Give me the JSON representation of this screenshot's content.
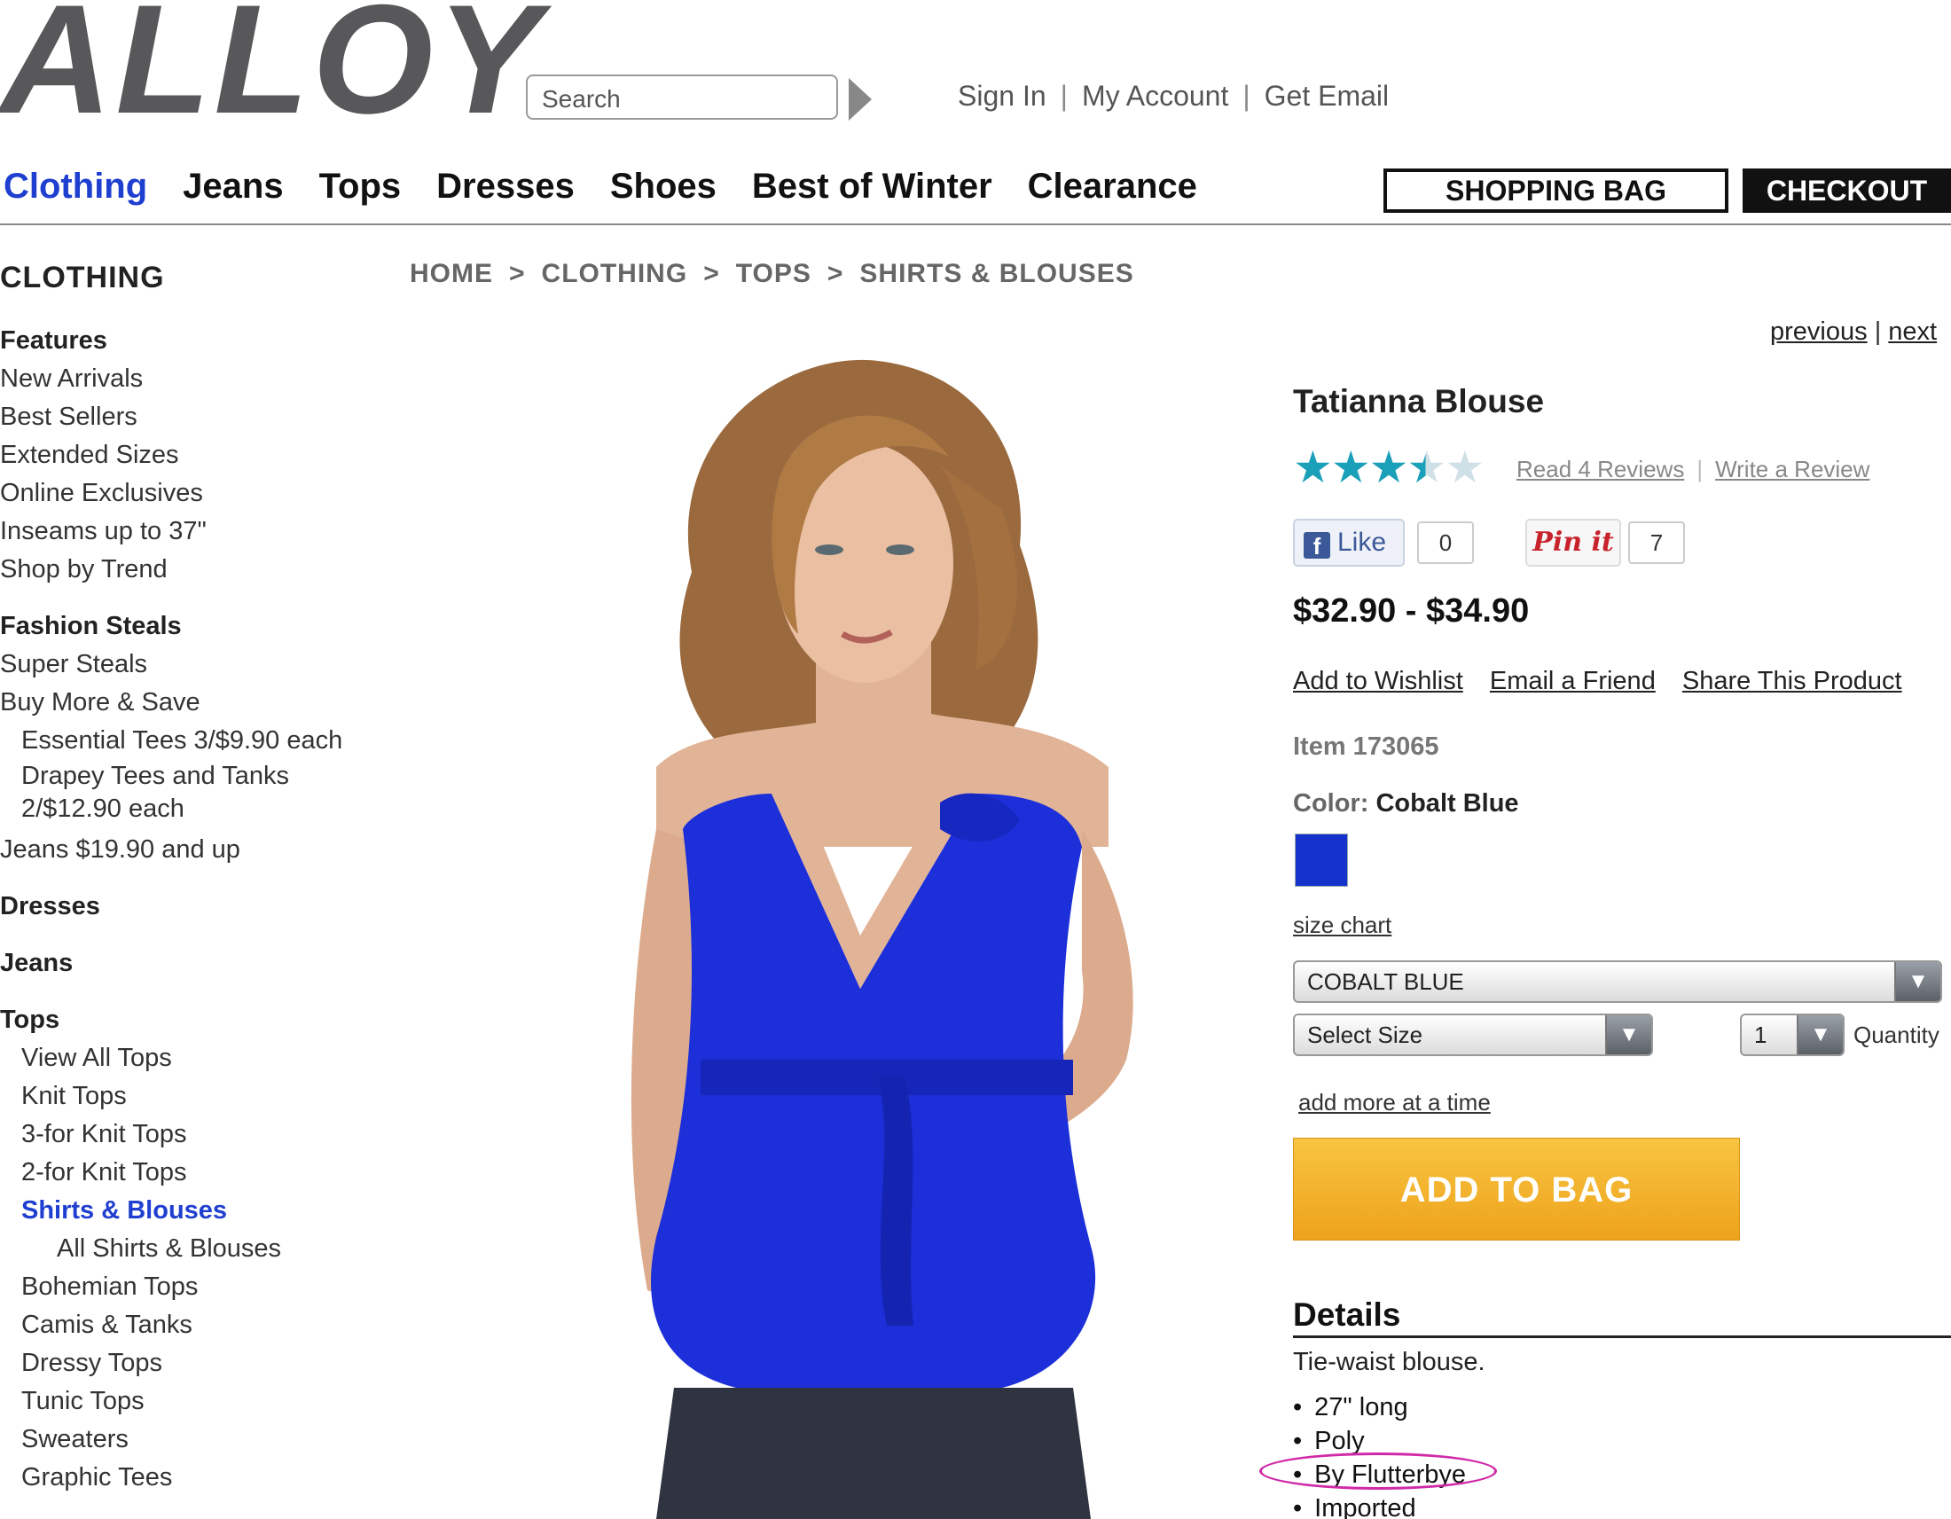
{
  "header": {
    "logo": "ALLOY",
    "search_placeholder": "Search",
    "sign_in": "Sign In",
    "my_account": "My Account",
    "get_email": "Get Email",
    "separator": "|"
  },
  "nav": {
    "items": [
      "Clothing",
      "Jeans",
      "Tops",
      "Dresses",
      "Shoes",
      "Best of Winter",
      "Clearance"
    ],
    "shopping_bag": "SHOPPING BAG",
    "checkout": "CHECKOUT"
  },
  "sidebar": {
    "title": "CLOTHING",
    "features": "Features",
    "new_arrivals": "New Arrivals",
    "best_sellers": "Best Sellers",
    "extended_sizes": "Extended Sizes",
    "online_exclusives": "Online Exclusives",
    "inseams": "Inseams up to 37\"",
    "shop_by_trend": "Shop by Trend",
    "fashion_steals": "Fashion Steals",
    "super_steals": "Super Steals",
    "buy_more": "Buy More & Save",
    "essential_tees": "Essential Tees 3/$9.90 each",
    "drapey_tees": "Drapey Tees and Tanks 2/$12.90 each",
    "jeans_deal": "Jeans $19.90 and up",
    "dresses": "Dresses",
    "jeans": "Jeans",
    "tops": "Tops",
    "view_all_tops": "View All Tops",
    "knit_tops": "Knit Tops",
    "three_for": "3-for Knit Tops",
    "two_for": "2-for Knit Tops",
    "shirts_blouses": "Shirts & Blouses",
    "all_shirts": "All Shirts & Blouses",
    "bohemian": "Bohemian Tops",
    "camis": "Camis & Tanks",
    "dressy": "Dressy Tops",
    "tunic": "Tunic Tops",
    "sweaters": "Sweaters",
    "graphic": "Graphic Tees"
  },
  "breadcrumb": {
    "items": [
      "HOME",
      "CLOTHING",
      "TOPS",
      "SHIRTS & BLOUSES"
    ],
    "separator": ">"
  },
  "pager": {
    "previous": "previous",
    "separator": "|",
    "next": "next"
  },
  "product": {
    "name": "Tatianna Blouse",
    "rating": 3.5,
    "rating_max": 5,
    "read_reviews": "Read 4 Reviews",
    "write_review": "Write a Review",
    "fb_like": "Like",
    "fb_count": "0",
    "pin_it": "Pin it",
    "pin_count": "7",
    "price": "$32.90 - $34.90",
    "add_to_wishlist": "Add to Wishlist",
    "email_friend": "Email a Friend",
    "share": "Share This Product",
    "item_number": "Item 173065",
    "color_label": "Color:",
    "color_value": "Cobalt Blue",
    "swatch_color": "#1533cc",
    "size_chart": "size chart",
    "color_select": "COBALT BLUE",
    "size_select": "Select Size",
    "qty_select": "1",
    "qty_label": "Quantity",
    "add_more": "add more at a time",
    "add_to_bag": "ADD TO BAG",
    "details_heading": "Details",
    "details_desc": "Tie-waist blouse.",
    "details_bullets": [
      "27\" long",
      "Poly",
      "By Flutterbye",
      "Imported"
    ]
  },
  "colors": {
    "accent_blue": "#1f3fd0",
    "button_orange": "#f2a92a",
    "annotation_magenta": "#d12aa8"
  }
}
